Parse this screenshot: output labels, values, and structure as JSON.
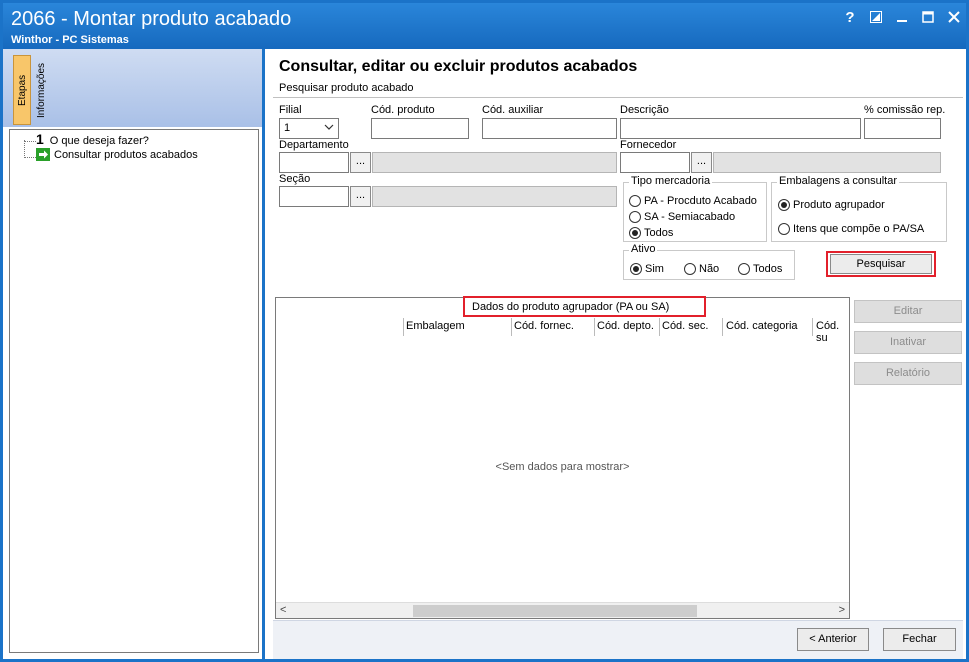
{
  "window": {
    "title": "2066 - Montar produto acabado",
    "subtitle": "Winthor - PC Sistemas",
    "help": "?"
  },
  "left": {
    "tabs": [
      "Etapas",
      "Informações"
    ],
    "steps": [
      {
        "num": "1",
        "label": "O que deseja fazer?"
      },
      {
        "label": "Consultar produtos acabados"
      }
    ]
  },
  "header": {
    "title": "Consultar, editar ou excluir produtos acabados",
    "subtitle": "Pesquisar produto acabado"
  },
  "form": {
    "filial": {
      "label": "Filial",
      "value": "1"
    },
    "cod_produto": {
      "label": "Cód. produto",
      "value": ""
    },
    "cod_auxiliar": {
      "label": "Cód. auxiliar",
      "value": ""
    },
    "descricao": {
      "label": "Descrição",
      "value": ""
    },
    "comissao": {
      "label": "% comissão rep.",
      "value": ""
    },
    "departamento": {
      "label": "Departamento",
      "value": ""
    },
    "fornecedor": {
      "label": "Fornecedor",
      "value": ""
    },
    "secao": {
      "label": "Seção",
      "value": ""
    },
    "ellipsis": "..."
  },
  "tipo_mercadoria": {
    "title": "Tipo mercadoria",
    "options": [
      "PA - Procduto Acabado",
      "SA - Semiacabado",
      "Todos"
    ],
    "selected": 2
  },
  "embalagens": {
    "title": "Embalagens a consultar",
    "options": [
      "Produto agrupador",
      "Itens que compõe o PA/SA"
    ],
    "selected": 0
  },
  "ativo": {
    "title": "Ativo",
    "options": [
      "Sim",
      "Não",
      "Todos"
    ],
    "selected": 0
  },
  "buttons": {
    "pesquisar": "Pesquisar",
    "editar": "Editar",
    "inativar": "Inativar",
    "relatorio": "Relatório",
    "anterior": "< Anterior",
    "fechar": "Fechar"
  },
  "grid": {
    "group_title": "Dados do produto agrupador (PA ou SA)",
    "columns": [
      "Embalagem",
      "Cód. fornec.",
      "Cód. depto.",
      "Cód. sec.",
      "Cód. categoria",
      "Cód. su"
    ],
    "empty": "<Sem dados para mostrar>"
  },
  "colors": {
    "title_bar": "#1b73c8",
    "highlight": "#e2202b",
    "active_tab": "#f8c66a"
  }
}
